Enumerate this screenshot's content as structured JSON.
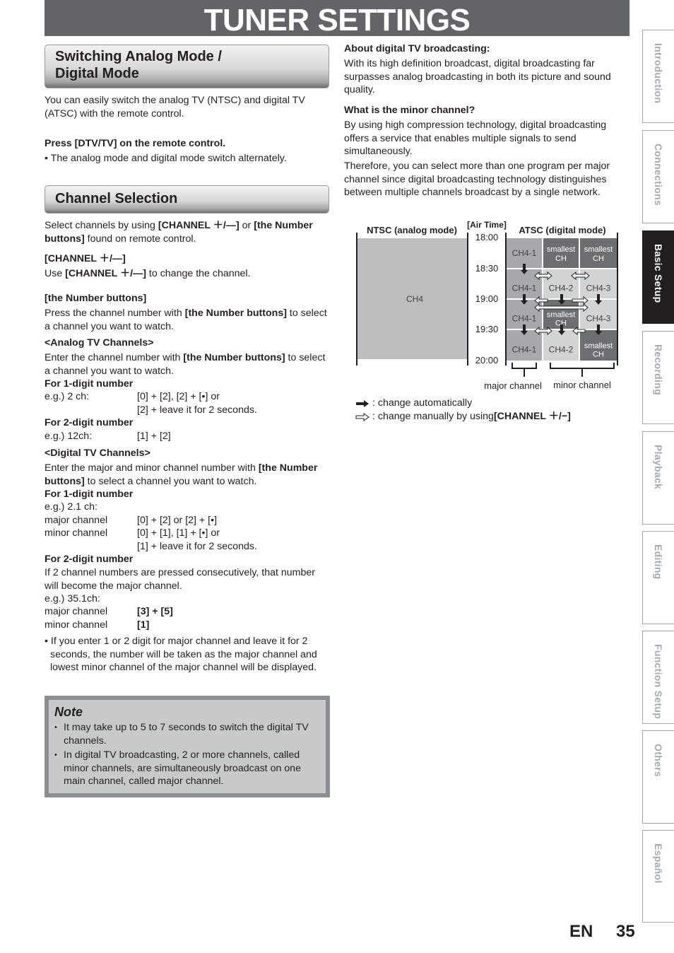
{
  "page": {
    "title": "TUNER SETTINGS",
    "language": "EN",
    "page_number": "35"
  },
  "left": {
    "section1": {
      "heading_line1": "Switching Analog Mode /",
      "heading_line2": "Digital Mode",
      "intro": "You can easily switch the analog TV (NTSC) and digital TV (ATSC) with the remote control.",
      "step": "Press [DTV/TV] on the remote control.",
      "step_bullet": "• The analog mode and digital mode switch alternately."
    },
    "section2": {
      "heading": "Channel Selection",
      "intro_a": "Select channels by using ",
      "intro_b": "[CHANNEL ＋/—]",
      "intro_c": " or ",
      "intro_d": "[the Number buttons]",
      "intro_e": " found on remote control.",
      "ch_heading": "[CHANNEL ＋/—]",
      "ch_text_a": "Use ",
      "ch_text_b": "[CHANNEL ＋/—]",
      "ch_text_c": " to change the channel.",
      "num_heading": "[the Number buttons]",
      "num_text_a": "Press the channel number with ",
      "num_text_b": "[the Number buttons]",
      "num_text_c": " to select a channel you want to watch.",
      "analog_heading": "<Analog TV Channels>",
      "analog_text_a": "Enter the channel number with ",
      "analog_text_b": "[the Number buttons]",
      "analog_text_c": " to select a channel you want to watch.",
      "analog_1digit": "For 1-digit number",
      "analog_1digit_eg": "e.g.) 2 ch:",
      "analog_1digit_keys1": "[0] + [2], [2] + [•] or",
      "analog_1digit_keys2": "[2] + leave it for 2 seconds.",
      "analog_2digit": "For 2-digit number",
      "analog_2digit_eg": "e.g.) 12ch:",
      "analog_2digit_keys": "[1] + [2]",
      "digital_heading": "<Digital TV Channels>",
      "digital_text_a": "Enter the major and minor channel number with ",
      "digital_text_b": "[the Number buttons]",
      "digital_text_c": " to select a channel you want to watch.",
      "digital_1digit": "For 1-digit number",
      "digital_1digit_eg": "e.g.) 2.1 ch:",
      "major_label": "major channel",
      "minor_label": "minor channel",
      "digital_1digit_major_keys": "[0] + [2] or [2] + [•]",
      "digital_1digit_minor_keys1": "[0] + [1], [1] + [•] or",
      "digital_1digit_minor_keys2": "[1] + leave it for 2 seconds.",
      "digital_2digit": "For 2-digit number",
      "digital_2digit_text": "If 2 channel numbers are pressed consecutively, that number will become the major channel.",
      "digital_2digit_eg": "e.g.) 35.1ch:",
      "digital_2digit_major_keys": "[3] + [5]",
      "digital_2digit_minor_keys": "[1]",
      "bullet": "• If you enter 1 or 2 digit for major channel and leave it for 2 seconds, the number will be taken as the major channel and lowest minor channel of the major channel will be displayed."
    },
    "note": {
      "title": "Note",
      "items": [
        "It may take up to 5 to 7 seconds to switch the digital TV channels.",
        "In digital TV broadcasting, 2 or more channels, called minor channels, are simultaneously broadcast on one main channel, called major channel."
      ]
    }
  },
  "right": {
    "about_heading": "About digital TV broadcasting:",
    "about_text": "With its high definition broadcast, digital broadcasting far surpasses analog broadcasting in both its picture and sound quality.",
    "minor_heading": "What is the minor channel?",
    "minor_text1": "By using high compression technology, digital broadcasting offers a service that enables multiple signals to send simultaneously.",
    "minor_text2": "Therefore, you can select more than one program per major channel since digital broadcasting technology distinguishes between multiple channels broadcast by a single network."
  },
  "diagram": {
    "ntsc_label": "NTSC (analog mode)",
    "airtime_label": "[Air Time]",
    "atsc_label": "ATSC (digital mode)",
    "ntsc_channel": "CH4",
    "times": [
      "18:00",
      "18:30",
      "19:00",
      "19:30",
      "20:00"
    ],
    "grid": [
      [
        {
          "l1": "CH4-1",
          "l2": "",
          "shade": "mid"
        },
        {
          "l1": "smallest",
          "l2": "CH",
          "shade": "dark"
        },
        {
          "l1": "smallest",
          "l2": "CH",
          "shade": "dark"
        }
      ],
      [
        {
          "l1": "CH4-1",
          "l2": "",
          "shade": "mid"
        },
        {
          "l1": "CH4-2",
          "l2": "",
          "shade": "light"
        },
        {
          "l1": "CH4-3",
          "l2": "",
          "shade": "light"
        }
      ],
      [
        {
          "l1": "CH4-1",
          "l2": "",
          "shade": "mid"
        },
        {
          "l1": "smallest",
          "l2": "CH",
          "shade": "dark"
        },
        {
          "l1": "CH4-3",
          "l2": "",
          "shade": "light"
        }
      ],
      [
        {
          "l1": "CH4-1",
          "l2": "",
          "shade": "mid"
        },
        {
          "l1": "CH4-2",
          "l2": "",
          "shade": "light"
        },
        {
          "l1": "smallest",
          "l2": "CH",
          "shade": "dark"
        }
      ]
    ],
    "major_caption": "major channel",
    "minor_caption": "minor channel",
    "legend_auto": ": change automatically",
    "legend_manual_a": ": change manually by using ",
    "legend_manual_b": "[CHANNEL ＋/−]",
    "colors": {
      "dark": "#6d6e71",
      "mid": "#a7a9ac",
      "light": "#d1d3d4",
      "ntsc": "#bcbec0"
    }
  },
  "side_tabs": [
    {
      "label": "Introduction",
      "active": false
    },
    {
      "label": "Connections",
      "active": false
    },
    {
      "label": "Basic Setup",
      "active": true
    },
    {
      "label": "Recording",
      "active": false
    },
    {
      "label": "Playback",
      "active": false
    },
    {
      "label": "Editing",
      "active": false
    },
    {
      "label": "Function Setup",
      "active": false
    },
    {
      "label": "Others",
      "active": false
    },
    {
      "label": "Español",
      "active": false
    }
  ]
}
